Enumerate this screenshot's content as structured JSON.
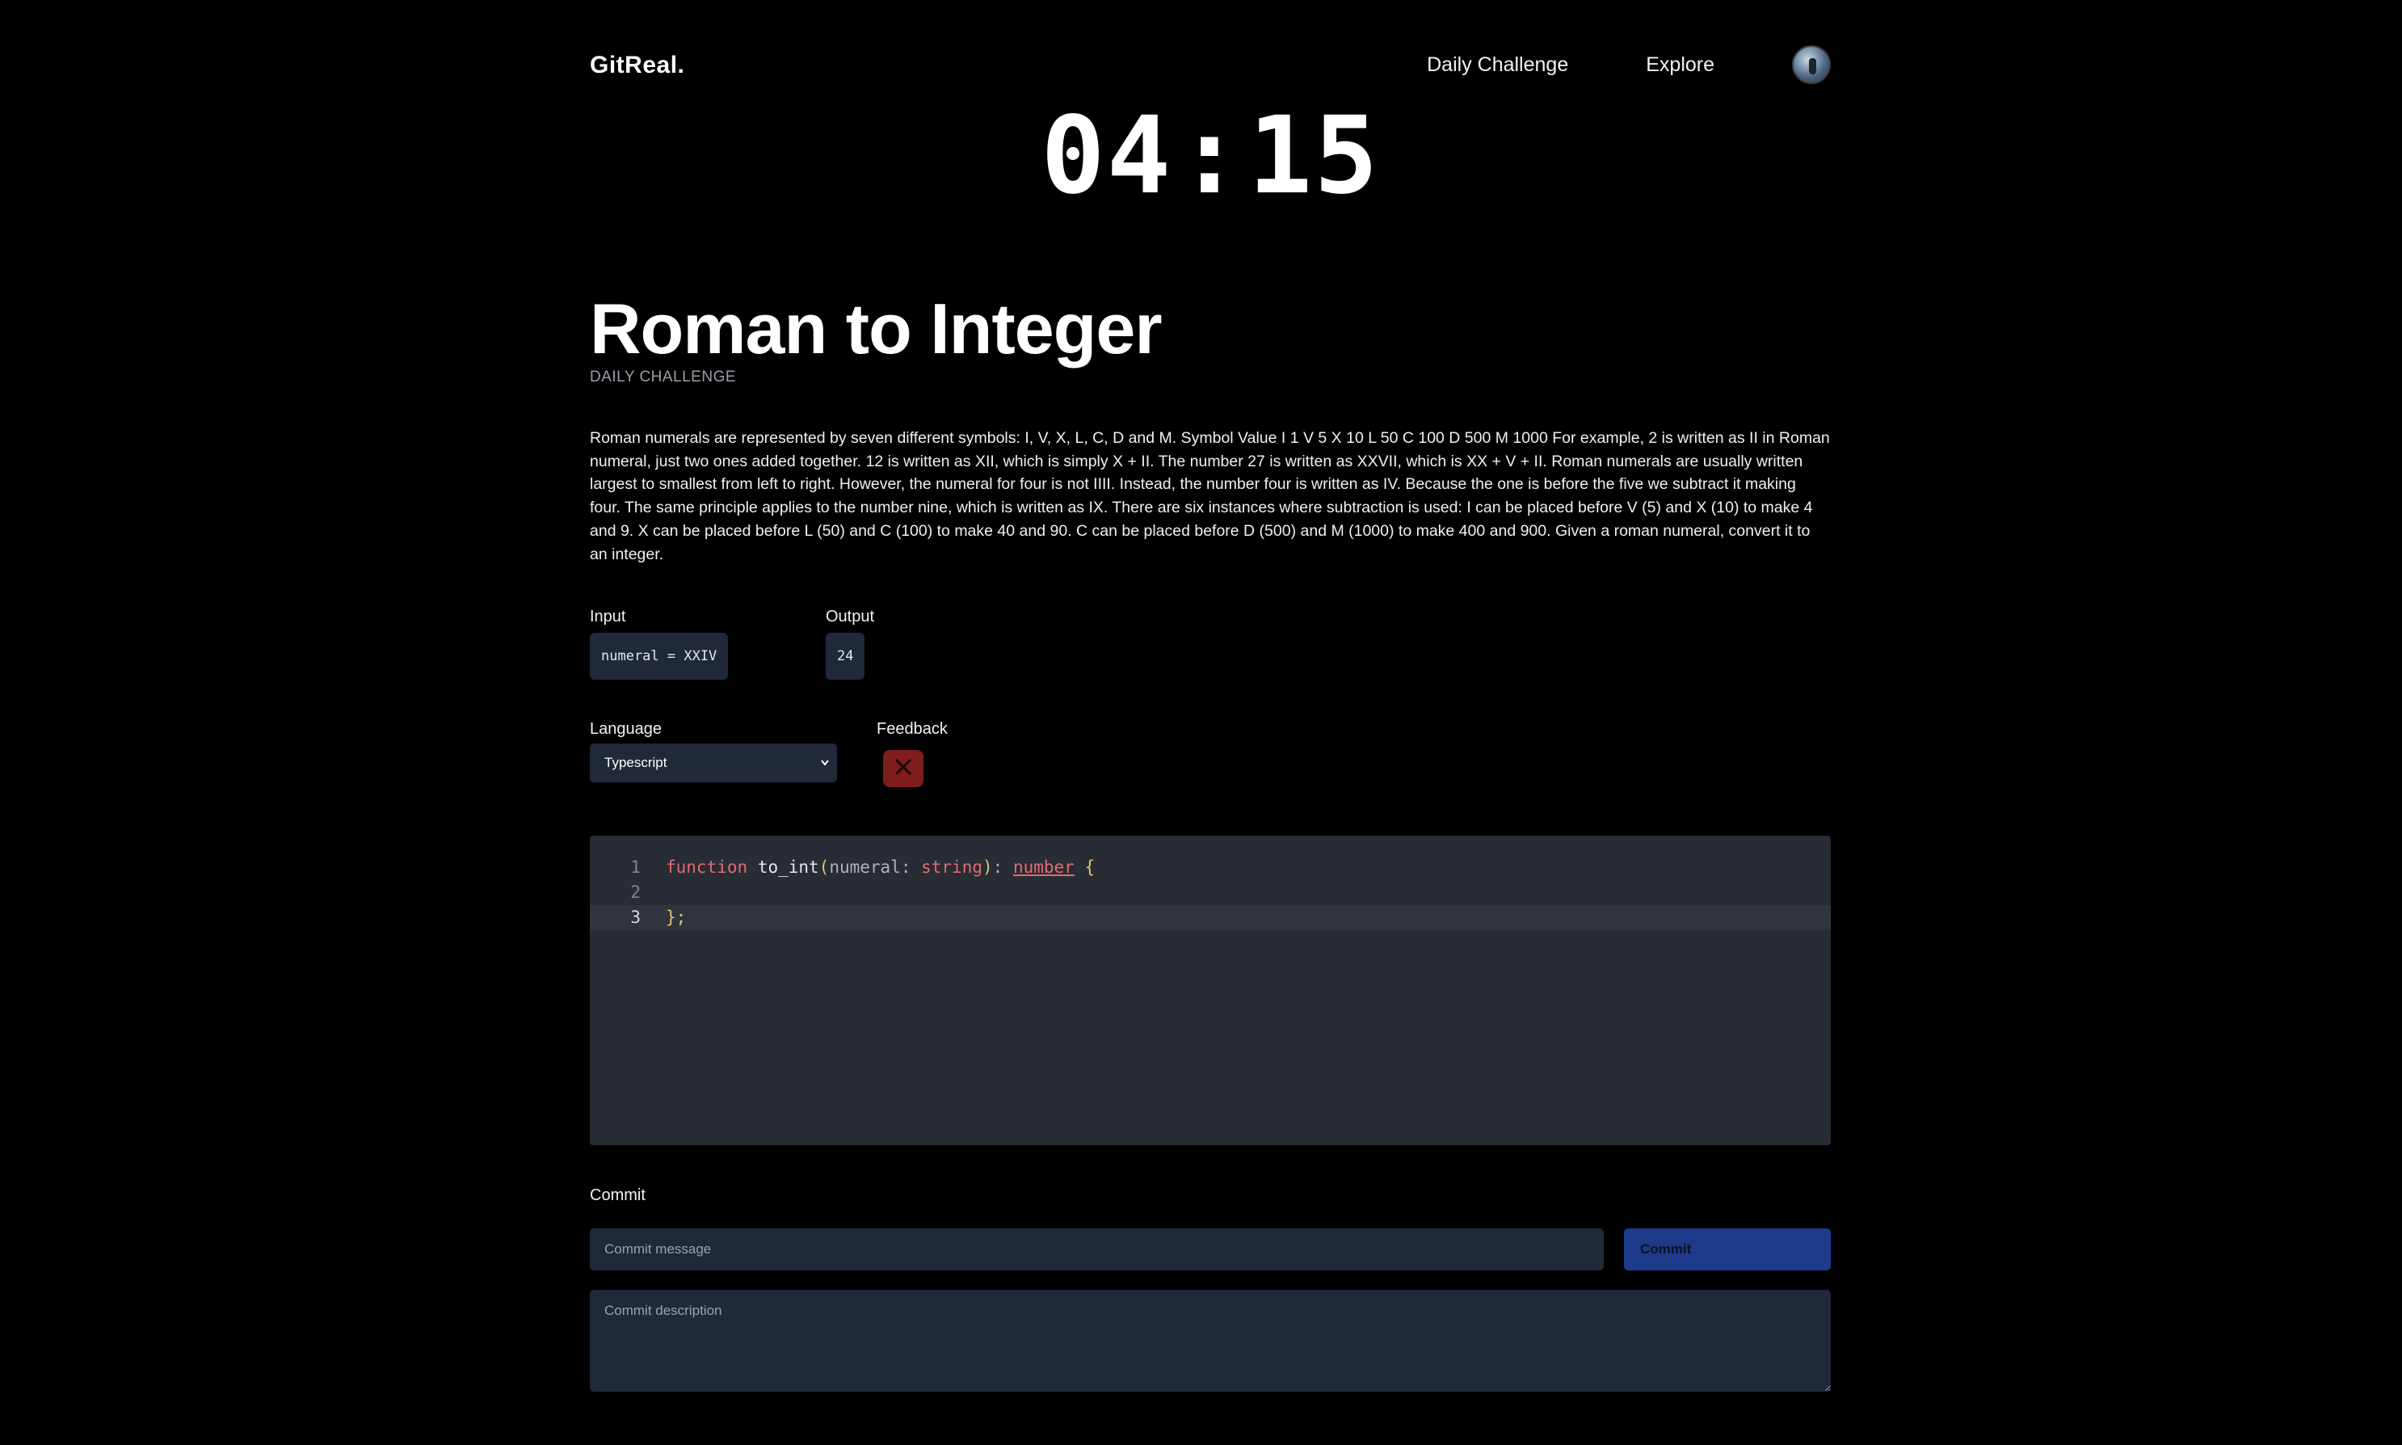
{
  "header": {
    "logo": "GitReal.",
    "nav": [
      "Daily Challenge",
      "Explore"
    ]
  },
  "timer": {
    "minutes": "04",
    "separator": ":",
    "seconds": "15"
  },
  "challenge": {
    "title": "Roman to Integer",
    "subtitle": "DAILY CHALLENGE",
    "description": "Roman numerals are represented by seven different symbols: I, V, X, L, C, D and M. Symbol Value I 1 V 5 X 10 L 50 C 100 D 500 M 1000 For example, 2 is written as II in Roman numeral, just two ones added together. 12 is written as XII, which is simply X + II. The number 27 is written as XXVII, which is XX + V + II. Roman numerals are usually written largest to smallest from left to right. However, the numeral for four is not IIII. Instead, the number four is written as IV. Because the one is before the five we subtract it making four. The same principle applies to the number nine, which is written as IX. There are six instances where subtraction is used: I can be placed before V (5) and X (10) to make 4 and 9. X can be placed before L (50) and C (100) to make 40 and 90. C can be placed before D (500) and M (1000) to make 400 and 900. Given a roman numeral, convert it to an integer."
  },
  "example": {
    "input_label": "Input",
    "input_value": "numeral = XXIV",
    "output_label": "Output",
    "output_value": "24"
  },
  "language": {
    "label": "Language",
    "selected": "Typescript"
  },
  "feedback": {
    "label": "Feedback",
    "status": "fail",
    "icon": "close-icon",
    "color": "#7f1d1d"
  },
  "editor": {
    "line_numbers": [
      "1",
      "2",
      "3"
    ],
    "active_line": 3,
    "tokens": {
      "kw_function": "function",
      "fn_name": "to_int",
      "paren_open": "(",
      "param": "numeral: ",
      "param_type": "string",
      "paren_close": ")",
      "colon": ": ",
      "return_type": "number",
      "brace_open": "{",
      "brace_close": "}",
      "semicolon": ";"
    }
  },
  "commit": {
    "label": "Commit",
    "message_placeholder": "Commit message",
    "button_label": "Commit",
    "description_placeholder": "Commit description",
    "button_color": "#1e3a8a"
  }
}
